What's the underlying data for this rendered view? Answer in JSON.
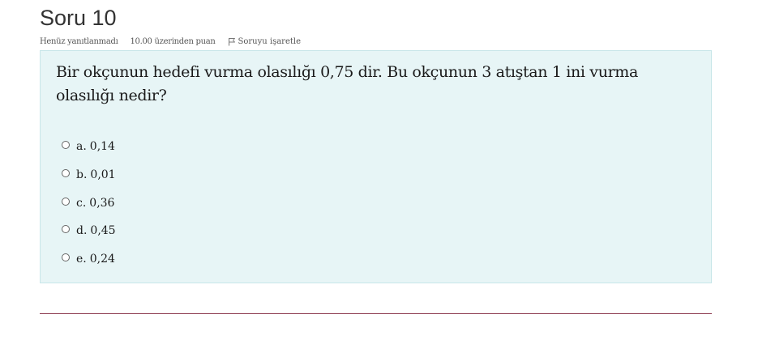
{
  "question": {
    "title": "Soru 10",
    "status": "Henüz yanıtlanmadı",
    "points": "10.00 üzerinden puan",
    "flag_label": "Soruyu işaretle",
    "flag_icon": "flag-icon",
    "text": "Bir okçunun hedefi vurma olasılığı 0,75 dir. Bu okçunun 3 atıştan 1 ini vurma olasılığı nedir?",
    "answers": [
      {
        "letter": "a.",
        "value": "0,14"
      },
      {
        "letter": "b.",
        "value": "0,01"
      },
      {
        "letter": "c.",
        "value": "0,36"
      },
      {
        "letter": "d.",
        "value": "0,45"
      },
      {
        "letter": "e.",
        "value": "0,24"
      }
    ]
  },
  "colors": {
    "box_background": "#e7f5f6",
    "box_border": "#c8e6e9",
    "divider": "#8c3a4f"
  }
}
